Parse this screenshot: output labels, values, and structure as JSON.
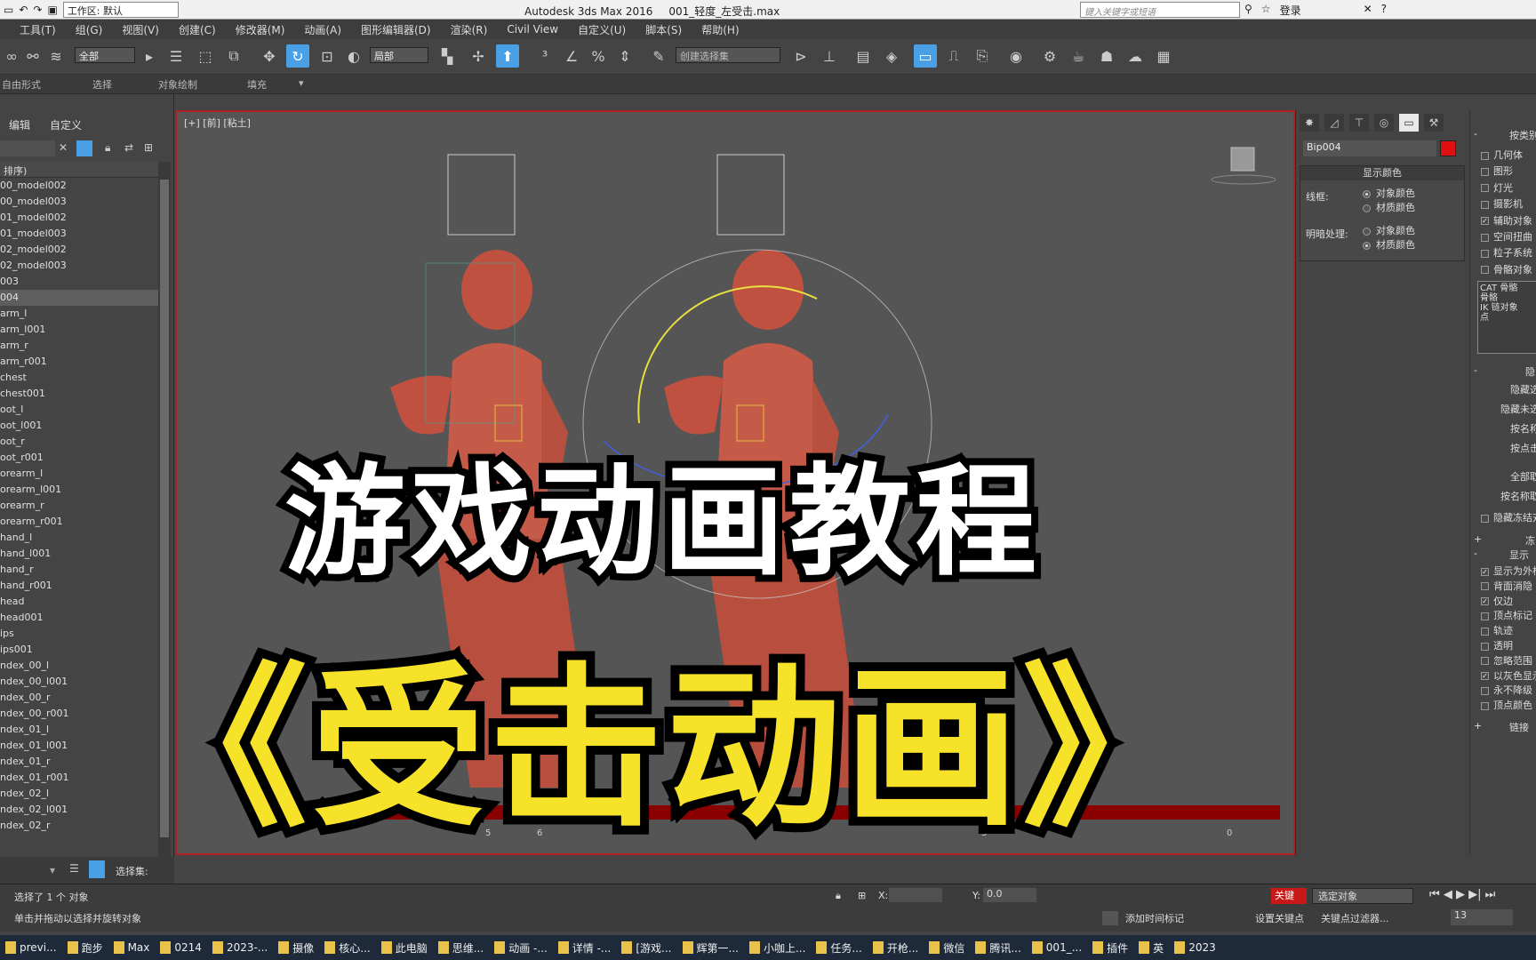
{
  "titlebar": {
    "workspace": "工作区: 默认",
    "app": "Autodesk 3ds Max 2016",
    "file": "001_轻度_左受击.max",
    "search_placeholder": "键入关键字或短语",
    "login": "登录"
  },
  "menu": [
    "工具(T)",
    "组(G)",
    "视图(V)",
    "创建(C)",
    "修改器(M)",
    "动画(A)",
    "图形编辑器(D)",
    "渲染(R)",
    "Civil View",
    "自定义(U)",
    "脚本(S)",
    "帮助(H)"
  ],
  "toolbar": {
    "filter": "全部",
    "coord": "局部",
    "named_set": "创建选择集"
  },
  "ribbon": [
    "自由形式",
    "选择",
    "对象绘制",
    "填充"
  ],
  "scene_explorer": {
    "tabs": [
      "编辑",
      "自定义"
    ],
    "header": "排序)",
    "items": [
      "00_model002",
      "00_model003",
      "01_model002",
      "01_model003",
      "02_model002",
      "02_model003",
      "003",
      "004",
      "arm_l",
      "arm_l001",
      "arm_r",
      "arm_r001",
      "chest",
      "chest001",
      "oot_l",
      "oot_l001",
      "oot_r",
      "oot_r001",
      "orearm_l",
      "orearm_l001",
      "orearm_r",
      "orearm_r001",
      "hand_l",
      "hand_l001",
      "hand_r",
      "hand_r001",
      "head",
      "head001",
      "ips",
      "ips001",
      "ndex_00_l",
      "ndex_00_l001",
      "ndex_00_r",
      "ndex_00_r001",
      "ndex_01_l",
      "ndex_01_l001",
      "ndex_01_r",
      "ndex_01_r001",
      "ndex_02_l",
      "ndex_02_l001",
      "ndex_02_r"
    ],
    "selected_index": 7,
    "selection_set": "选择集:"
  },
  "viewport": {
    "label": "[+] [前] [粘土]"
  },
  "command_panel": {
    "object_name": "Bip004",
    "object_color": "#e01010",
    "rollout_title": "显示颜色",
    "wire_label": "线框:",
    "shade_label": "明暗处理:",
    "opt_object": "对象颜色",
    "opt_material": "材质颜色",
    "category_title": "按类别",
    "categories": [
      "几何体",
      "图形",
      "灯光",
      "摄影机",
      "辅助对象",
      "空间扭曲",
      "粒子系统",
      "骨骼对象"
    ],
    "categories_checked": [
      false,
      false,
      false,
      false,
      true,
      false,
      false,
      false
    ],
    "list_items": [
      "CAT 骨骼",
      "骨骼",
      "IK 链对象",
      "点"
    ],
    "hide_title": "隐",
    "hide_buttons": [
      "隐藏选",
      "隐藏未选",
      "按名称",
      "按点击",
      "全部取",
      "按名称取"
    ],
    "freeze_label": "隐藏冻结对",
    "freeze_title": "冻",
    "display_title": "显示",
    "display_options": [
      "显示为外框",
      "背面消隐",
      "仅边",
      "顶点标记",
      "轨迹",
      "透明",
      "忽略范围",
      "以灰色显示",
      "永不降级",
      "顶点颜色"
    ],
    "display_checked": [
      true,
      false,
      true,
      false,
      false,
      false,
      false,
      true,
      false,
      false
    ],
    "link_title": "链接"
  },
  "timeline_ticks": [
    "5",
    "6",
    "5",
    "0"
  ],
  "status": {
    "line1": "选择了 1 个 对象",
    "line2": "单击并拖动以选择并旋转对象",
    "x_label": "X:",
    "y_label": "Y:",
    "y_value": "0.0",
    "add_time_tag": "添加时间标记",
    "set_key": "设置关键点",
    "key_filters": "关键点过滤器...",
    "selected_objects": "选定对象",
    "frame": "13",
    "auto_key": "关键"
  },
  "taskbar": [
    "previ...",
    "跑步",
    "Max",
    "0214",
    "2023-...",
    "摄像",
    "核心...",
    "此电脑",
    "思维...",
    "动画 -...",
    "详情 -...",
    "[游戏...",
    "辉第一...",
    "小咖上...",
    "任务...",
    "开枪...",
    "微信",
    "腾讯...",
    "001_...",
    "插件",
    "英",
    "2023"
  ],
  "overlay": {
    "line1": "游戏动画教程",
    "line2": "《受击动画》"
  }
}
